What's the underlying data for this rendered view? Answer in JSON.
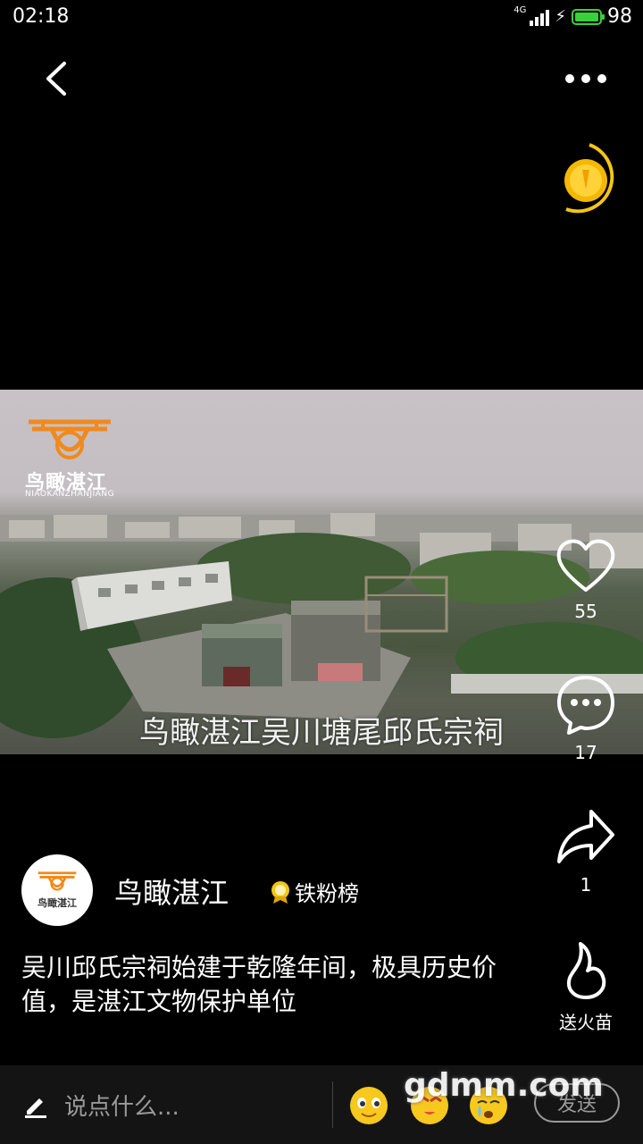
{
  "status_bar": {
    "time": "02:18",
    "network": "4G",
    "battery": "98"
  },
  "header": {
    "back_icon": "back-arrow-icon",
    "more_icon": "more-dots-icon",
    "coin_icon": "gold-coin-icon"
  },
  "video": {
    "watermark_name": "鸟瞰湛江",
    "watermark_pinyin": "NIAOKANZHANJIANG",
    "caption": "鸟瞰湛江吴川塘尾邱氏宗祠"
  },
  "actions": {
    "like_count": "55",
    "comment_count": "17",
    "share_count": "1",
    "fire_label": "送火苗"
  },
  "author": {
    "name": "鸟瞰湛江",
    "avatar_text": "鸟瞰湛江",
    "badge_label": "铁粉榜"
  },
  "description": "吴川邱氏宗祠始建于乾隆年间，极具历史价值，是湛江文物保护单位",
  "bottom_bar": {
    "comment_placeholder": "说点什么...",
    "send_label": "发送",
    "site_watermark": "gdmm.com"
  },
  "colors": {
    "accent_orange": "#f08a1c",
    "coin_gold": "#f5c518",
    "battery_green": "#3ccf3c"
  }
}
